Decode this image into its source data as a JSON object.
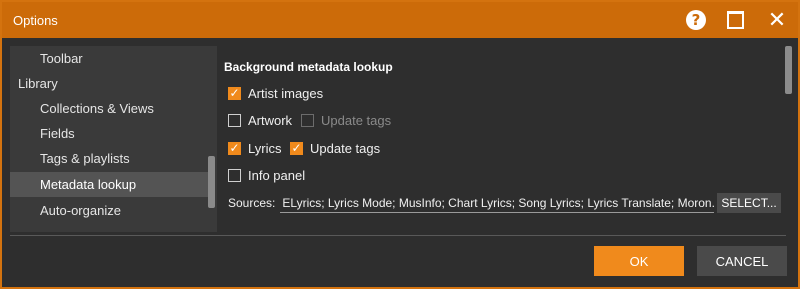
{
  "window": {
    "title": "Options",
    "accent": "#cc6b09"
  },
  "nav": {
    "items": [
      {
        "label": "Toolbar",
        "level": 2
      },
      {
        "label": "Library",
        "level": 1
      },
      {
        "label": "Collections & Views",
        "level": 2
      },
      {
        "label": "Fields",
        "level": 2
      },
      {
        "label": "Tags & playlists",
        "level": 2
      },
      {
        "label": "Metadata lookup",
        "level": 2,
        "selected": true
      },
      {
        "label": "Auto-organize",
        "level": 2
      }
    ]
  },
  "main": {
    "section_title": "Background metadata lookup",
    "options": {
      "artist_images": {
        "label": "Artist images",
        "checked": true
      },
      "artwork": {
        "label": "Artwork",
        "checked": false
      },
      "artwork_update_tags": {
        "label": "Update tags",
        "checked": false,
        "disabled": true
      },
      "lyrics": {
        "label": "Lyrics",
        "checked": true
      },
      "lyrics_update_tags": {
        "label": "Update tags",
        "checked": true
      },
      "info_panel": {
        "label": "Info panel",
        "checked": false
      }
    },
    "sources": {
      "label": "Sources:",
      "value": "ELyrics; Lyrics Mode; MusInfo; Chart Lyrics; Song Lyrics; Lyrics Translate; Moron.",
      "select_label": "SELECT..."
    }
  },
  "footer": {
    "ok_label": "OK",
    "cancel_label": "CANCEL"
  }
}
